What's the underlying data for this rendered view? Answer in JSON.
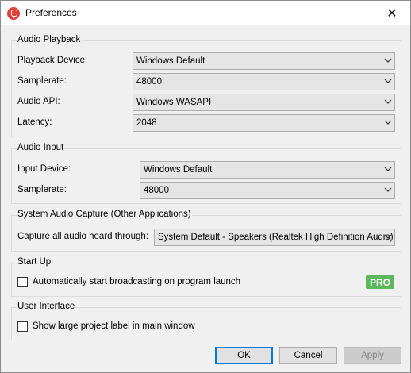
{
  "window": {
    "title": "Preferences",
    "close_glyph": "✕"
  },
  "audio_playback": {
    "label": "Audio Playback",
    "playback_device_label": "Playback Device:",
    "playback_device_value": "Windows Default",
    "samplerate_label": "Samplerate:",
    "samplerate_value": "48000",
    "audio_api_label": "Audio API:",
    "audio_api_value": "Windows WASAPI",
    "latency_label": "Latency:",
    "latency_value": "2048"
  },
  "audio_input": {
    "label": "Audio Input",
    "input_device_label": "Input Device:",
    "input_device_value": "Windows Default",
    "samplerate_label": "Samplerate:",
    "samplerate_value": "48000"
  },
  "system_capture": {
    "label": "System Audio Capture (Other Applications)",
    "capture_label": "Capture all audio heard through:",
    "capture_value": "System Default - Speakers (Realtek High Definition Audio)"
  },
  "startup": {
    "label": "Start Up",
    "auto_broadcast_label": "Automatically start broadcasting on program launch",
    "auto_broadcast_checked": false,
    "pro_badge": "PRO"
  },
  "user_interface": {
    "label": "User Interface",
    "large_label_label": "Show large project label in main window",
    "large_label_checked": false
  },
  "buttons": {
    "ok": "OK",
    "cancel": "Cancel",
    "apply": "Apply"
  },
  "colors": {
    "pro_badge": "#5cb85c",
    "app_icon": "#e0413a",
    "default_button_border": "#0078d7"
  }
}
